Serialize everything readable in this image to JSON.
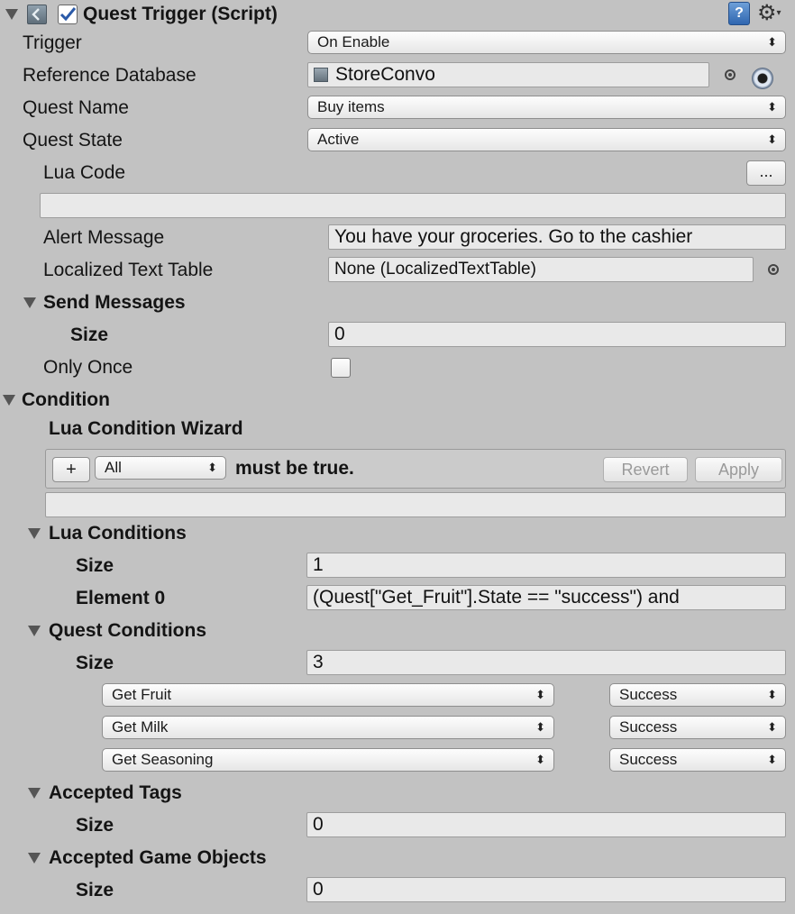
{
  "header": {
    "title": "Quest Trigger (Script)",
    "enabled": true
  },
  "fields": {
    "trigger_label": "Trigger",
    "trigger_value": "On Enable",
    "ref_db_label": "Reference Database",
    "ref_db_value": "StoreConvo",
    "quest_name_label": "Quest Name",
    "quest_name_value": "Buy items",
    "quest_state_label": "Quest State",
    "quest_state_value": "Active",
    "lua_code_label": "Lua Code",
    "lua_code_button": "...",
    "lua_code_value": "",
    "alert_label": "Alert Message",
    "alert_value": "You have your groceries. Go to the cashier",
    "localized_label": "Localized Text Table",
    "localized_value": "None (LocalizedTextTable)",
    "send_messages_label": "Send Messages",
    "send_size_label": "Size",
    "send_size_value": "0",
    "only_once_label": "Only Once",
    "only_once_checked": false
  },
  "condition": {
    "label": "Condition",
    "wizard_label": "Lua Condition Wizard",
    "add_button": "+",
    "mode_value": "All",
    "must_be_true": "must be true.",
    "revert_button": "Revert",
    "apply_button": "Apply",
    "wizard_output": "",
    "lua_conditions_label": "Lua Conditions",
    "lua_size_label": "Size",
    "lua_size_value": "1",
    "element0_label": "Element 0",
    "element0_value": "(Quest[\"Get_Fruit\"].State == \"success\") and",
    "quest_conditions_label": "Quest Conditions",
    "quest_size_label": "Size",
    "quest_size_value": "3",
    "quest_rows": [
      {
        "quest": "Get Fruit",
        "state": "Success"
      },
      {
        "quest": "Get Milk",
        "state": "Success"
      },
      {
        "quest": "Get Seasoning",
        "state": "Success"
      }
    ],
    "accepted_tags_label": "Accepted Tags",
    "tags_size_label": "Size",
    "tags_size_value": "0",
    "accepted_go_label": "Accepted Game Objects",
    "go_size_label": "Size",
    "go_size_value": "0"
  },
  "icons": {
    "foldout": "triangle-down-icon",
    "script": "script-icon",
    "help": "help-icon",
    "settings": "gear-icon",
    "object_picker": "object-picker-icon",
    "asset": "asset-icon",
    "popup": "updown-arrows-icon"
  }
}
